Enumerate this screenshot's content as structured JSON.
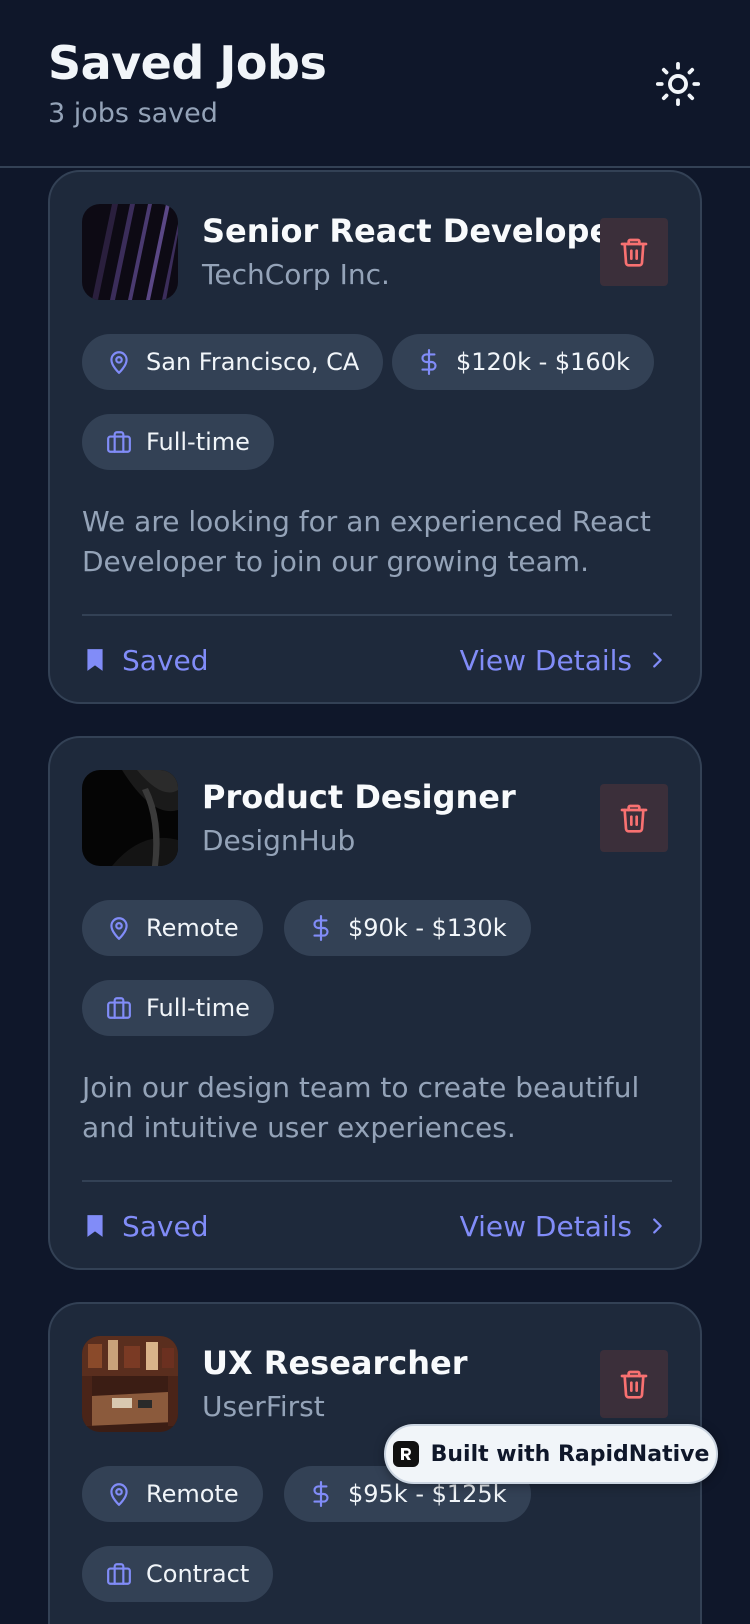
{
  "header": {
    "title": "Saved Jobs",
    "subtitle": "3 jobs saved",
    "theme_icon": "sun-icon"
  },
  "jobs": [
    {
      "title": "Senior React Developer",
      "company": "TechCorp Inc.",
      "location": "San Francisco, CA",
      "salary": "$120k - $160k",
      "type": "Full-time",
      "description": "We are looking for an experienced React Developer to join our growing team.",
      "saved_label": "Saved",
      "view_label": "View Details"
    },
    {
      "title": "Product Designer",
      "company": "DesignHub",
      "location": "Remote",
      "salary": "$90k - $130k",
      "type": "Full-time",
      "description": "Join our design team to create beautiful and intuitive user experiences.",
      "saved_label": "Saved",
      "view_label": "View Details"
    },
    {
      "title": "UX Researcher",
      "company": "UserFirst",
      "location": "Remote",
      "salary": "$95k - $125k",
      "type": "Contract"
    }
  ],
  "badge": {
    "label": "Built with RapidNative"
  },
  "colors": {
    "background": "#0f172a",
    "card": "#1e293b",
    "accent": "#818cf8",
    "danger": "#f87171",
    "muted": "#94a3b8"
  }
}
